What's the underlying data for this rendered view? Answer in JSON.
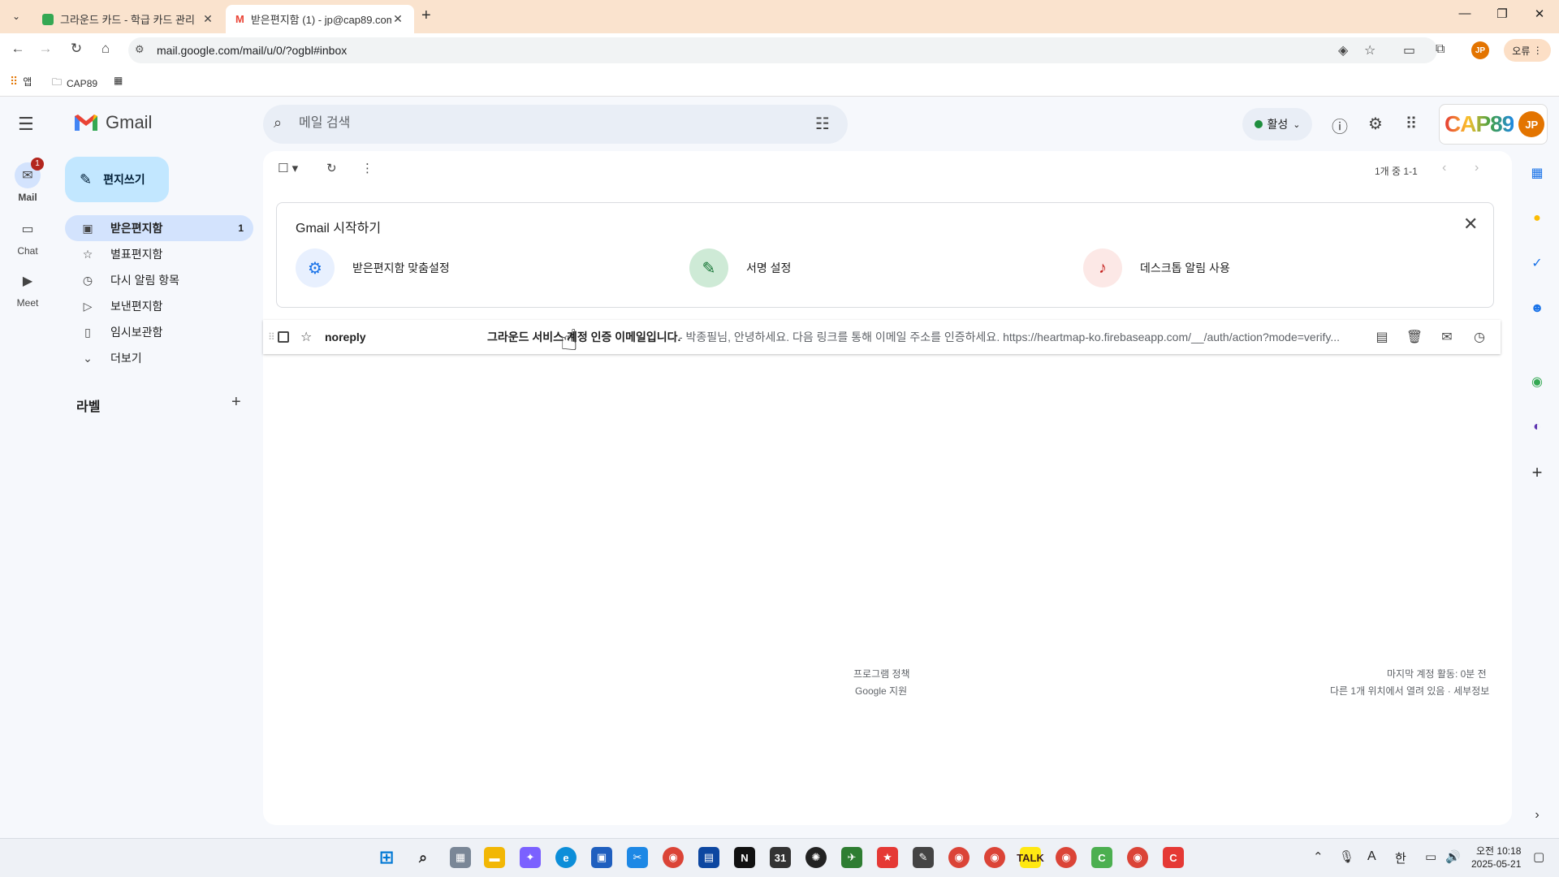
{
  "browser": {
    "tabs": [
      {
        "title": "그라운드 카드 - 학급 카드 관리",
        "active": false
      },
      {
        "title": "받은편지함 (1) - jp@cap89.com",
        "active": true
      }
    ],
    "url": "mail.google.com/mail/u/0/?ogbl#inbox",
    "profile_initials": "JP",
    "error_chip": "오류",
    "bookmarks": [
      {
        "label": "앱",
        "icon": "apps-grid-icon"
      },
      {
        "label": "CAP89",
        "icon": "folder-icon"
      }
    ]
  },
  "gmail": {
    "logo_text": "Gmail",
    "search_placeholder": "메일 검색",
    "status_label": "활성",
    "brand_logo_text": "CAP89",
    "avatar_initials": "JP",
    "rail": [
      {
        "label": "Mail",
        "badge": "1",
        "icon": "mail-icon"
      },
      {
        "label": "Chat",
        "icon": "chat-icon"
      },
      {
        "label": "Meet",
        "icon": "video-icon"
      }
    ],
    "compose_label": "편지쓰기",
    "nav": [
      {
        "label": "받은편지함",
        "count": "1",
        "icon": "inbox-icon",
        "active": true
      },
      {
        "label": "별표편지함",
        "icon": "star-icon"
      },
      {
        "label": "다시 알림 항목",
        "icon": "clock-icon"
      },
      {
        "label": "보낸편지함",
        "icon": "send-icon"
      },
      {
        "label": "임시보관함",
        "icon": "draft-icon"
      },
      {
        "label": "더보기",
        "icon": "chevron-down-icon"
      }
    ],
    "labels_heading": "라벨",
    "pager_text": "1개 중 1-1",
    "get_started": {
      "title": "Gmail 시작하기",
      "items": [
        {
          "label": "받은편지함 맞춤설정",
          "icon": "gear-icon",
          "color": "#e8f0fe"
        },
        {
          "label": "서명 설정",
          "icon": "pen-icon",
          "color": "#ceead6"
        },
        {
          "label": "데스크톱 알림 사용",
          "icon": "bell-icon",
          "color": "#fce8e6"
        }
      ]
    },
    "emails": [
      {
        "sender": "noreply",
        "subject": "그라운드 서비스 계정 인증 이메일입니다.",
        "snippet": "- 박종필님, 안녕하세요. 다음 링크를 통해 이메일 주소를 인증하세요. https://heartmap-ko.firebaseapp.com/__/auth/action?mode=verify..."
      }
    ],
    "footer": {
      "policy": "프로그램 정책",
      "support": "Google 지원",
      "activity": "마지막 계정 활동: 0분 전",
      "details": "다른 1개 위치에서 열려 있음 · 세부정보"
    }
  },
  "taskbar": {
    "time": "오전 10:18",
    "date": "2025-05-21",
    "ime_a": "A",
    "ime_han": "한"
  },
  "colors": {
    "tabbar": "#fae3ce",
    "compose": "#c2e7ff",
    "nav_active": "#d3e3fd",
    "avatar": "#e37400"
  }
}
